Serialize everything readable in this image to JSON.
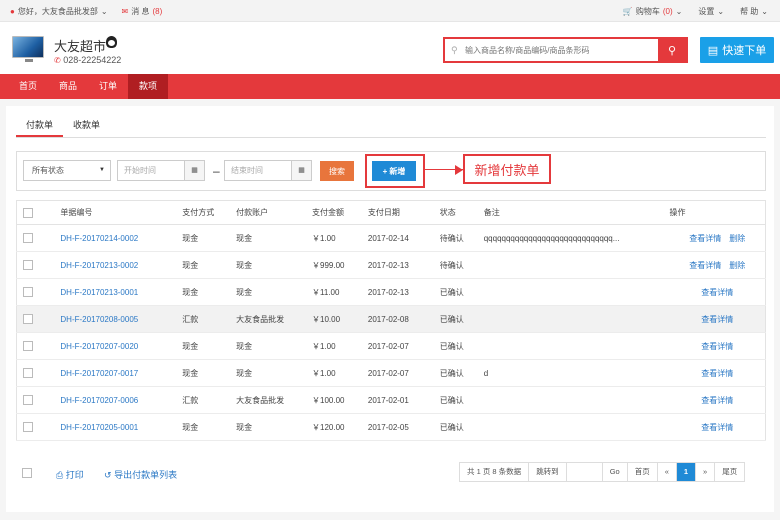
{
  "topbar": {
    "greeting": "您好，大友食品批发部",
    "messages_label": "消 息",
    "messages_count": "(8)",
    "cart_label": "购物车",
    "cart_count": "(0)",
    "settings_label": "设置",
    "help_label": "帮 助"
  },
  "header": {
    "store_name": "大友超市",
    "phone": "028-22254222",
    "search_placeholder": "输入商品名称/商品编码/商品条形码",
    "quick_order_label": "快速下单"
  },
  "nav": {
    "items": [
      "首页",
      "商品",
      "订单",
      "款项"
    ],
    "active_index": 3
  },
  "tabs": [
    "付款单",
    "收款单"
  ],
  "filter": {
    "status_selected": "所有状态",
    "start_placeholder": "开始时间",
    "end_placeholder": "结束时间",
    "search_label": "搜索",
    "new_label": "新增",
    "annotation": "新增付款单"
  },
  "table": {
    "headers": [
      "单据编号",
      "支付方式",
      "付款账户",
      "支付金额",
      "支付日期",
      "状态",
      "备注",
      "操作"
    ],
    "rows": [
      {
        "no": "DH-F-20170214-0002",
        "pay": "现金",
        "acct": "现金",
        "amt": "￥1.00",
        "date": "2017-02-14",
        "status": "待确认",
        "note": "qqqqqqqqqqqqqqqqqqqqqqqqqqqqq...",
        "op_view": "查看详情",
        "op_delete": "删除"
      },
      {
        "no": "DH-F-20170213-0002",
        "pay": "现金",
        "acct": "现金",
        "amt": "￥999.00",
        "date": "2017-02-13",
        "status": "待确认",
        "note": "",
        "op_view": "查看详情",
        "op_delete": "删除"
      },
      {
        "no": "DH-F-20170213-0001",
        "pay": "现金",
        "acct": "现金",
        "amt": "￥11.00",
        "date": "2017-02-13",
        "status": "已确认",
        "note": "",
        "op_view": "查看详情",
        "op_delete": ""
      },
      {
        "no": "DH-F-20170208-0005",
        "pay": "汇款",
        "acct": "大友食品批发",
        "amt": "￥10.00",
        "date": "2017-02-08",
        "status": "已确认",
        "note": "",
        "op_view": "查看详情",
        "op_delete": ""
      },
      {
        "no": "DH-F-20170207-0020",
        "pay": "现金",
        "acct": "现金",
        "amt": "￥1.00",
        "date": "2017-02-07",
        "status": "已确认",
        "note": "",
        "op_view": "查看详情",
        "op_delete": ""
      },
      {
        "no": "DH-F-20170207-0017",
        "pay": "现金",
        "acct": "现金",
        "amt": "￥1.00",
        "date": "2017-02-07",
        "status": "已确认",
        "note": "d",
        "op_view": "查看详情",
        "op_delete": ""
      },
      {
        "no": "DH-F-20170207-0006",
        "pay": "汇款",
        "acct": "大友食品批发",
        "amt": "￥100.00",
        "date": "2017-02-01",
        "status": "已确认",
        "note": "",
        "op_view": "查看详情",
        "op_delete": ""
      },
      {
        "no": "DH-F-20170205-0001",
        "pay": "现金",
        "acct": "现金",
        "amt": "￥120.00",
        "date": "2017-02-05",
        "status": "已确认",
        "note": "",
        "op_view": "查看详情",
        "op_delete": ""
      }
    ],
    "highlighted_row": 3
  },
  "footer": {
    "print_label": "打印",
    "export_label": "导出付款单列表"
  },
  "pager": {
    "summary": "共 1 页 8 条数据",
    "goto_label": "跳转到",
    "go_label": "Go",
    "first_label": "首页",
    "prev_label": "«",
    "current": "1",
    "next_label": "»",
    "last_label": "尾页"
  },
  "colors": {
    "brand_red": "#e4393c",
    "nav_active": "#b01e22",
    "primary_blue": "#1f8ad6",
    "search_orange": "#e8753c"
  }
}
